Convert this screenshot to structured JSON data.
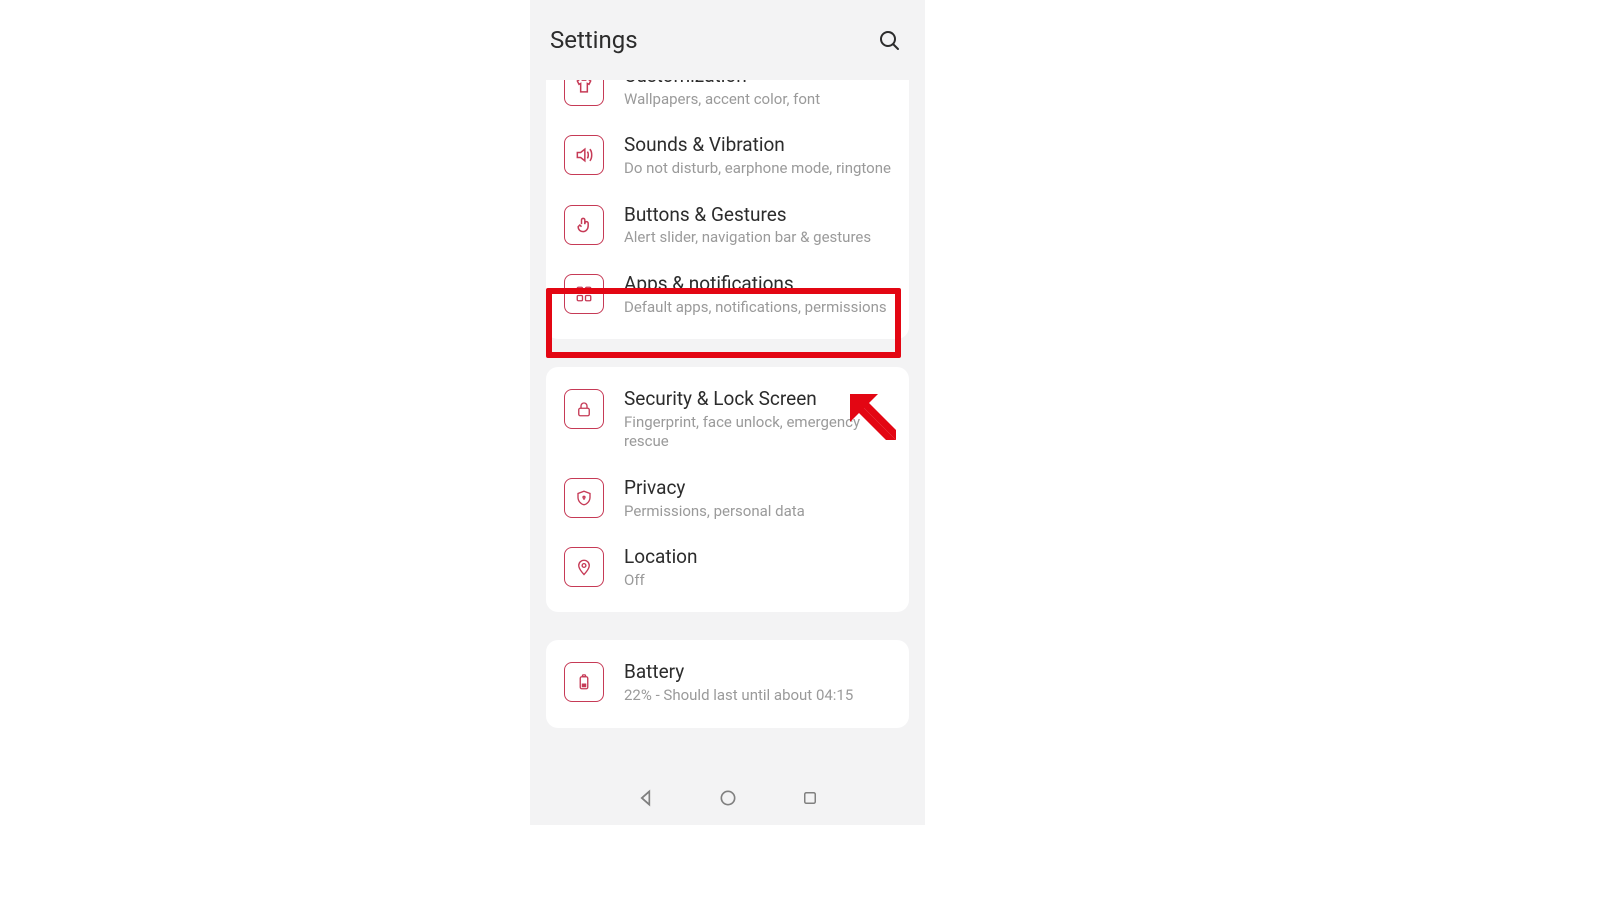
{
  "header": {
    "title": "Settings"
  },
  "group1": {
    "customization": {
      "title": "Customization",
      "sub": "Wallpapers, accent color, font"
    },
    "sounds": {
      "title": "Sounds & Vibration",
      "sub": "Do not disturb, earphone mode, ringtone"
    },
    "buttons": {
      "title": "Buttons & Gestures",
      "sub": "Alert slider, navigation bar & gestures"
    },
    "apps": {
      "title": "Apps & notifications",
      "sub": "Default apps, notifications, permissions"
    }
  },
  "group2": {
    "security": {
      "title": "Security & Lock Screen",
      "sub": "Fingerprint, face unlock, emergency rescue"
    },
    "privacy": {
      "title": "Privacy",
      "sub": "Permissions, personal data"
    },
    "location": {
      "title": "Location",
      "sub": "Off"
    }
  },
  "group3": {
    "battery": {
      "title": "Battery",
      "sub": "22% - Should last until about 04:15"
    }
  },
  "accent": "#c63a56",
  "highlight_color": "#e30613"
}
